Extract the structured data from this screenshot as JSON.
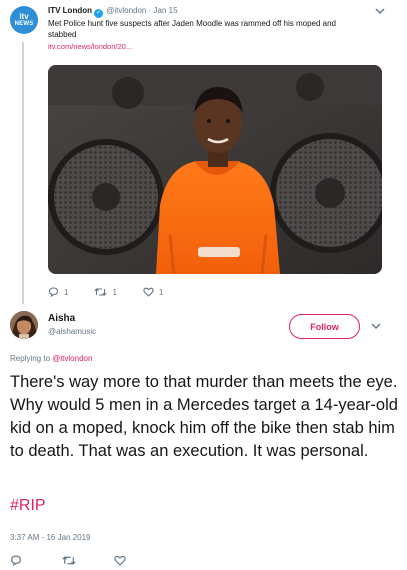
{
  "parent_tweet": {
    "avatar_line1": "itv",
    "avatar_line2": "NEWS",
    "name": "ITV London",
    "verified_mark": "✓",
    "handle": "@itvlondon",
    "separator": "·",
    "date": "Jan 15",
    "text": "Met Police hunt five suspects after Jaden Moodle was rammed off his moped and stabbed",
    "link": "itv.com/news/london/20...",
    "photo_icon": "photo-of-teen-in-orange-hoodie",
    "reply_count": "1",
    "retweet_count": "1",
    "like_count": "1"
  },
  "main_tweet": {
    "name": "Aisha",
    "handle": "@aishamusic",
    "follow_label": "Follow",
    "reply_prefix": "Replying to",
    "reply_handle": "@itvlondon",
    "text": "There's way more to that murder than meets the eye. Why would 5 men in a Mercedes target a 14-year-old kid on a moped, knock him off the bike then stab him to death. That was an execution. It was personal.",
    "hashtag": "#RIP",
    "timestamp": "3:37 AM - 16 Jan 2019"
  },
  "colors": {
    "accent": "#e0245e",
    "muted": "#657786",
    "text": "#14171a",
    "verified": "#1da1f2",
    "itv_blue": "#2f8fd6"
  },
  "icons": [
    "chevron-down-icon",
    "reply-icon",
    "retweet-icon",
    "like-icon",
    "verified-icon"
  ]
}
